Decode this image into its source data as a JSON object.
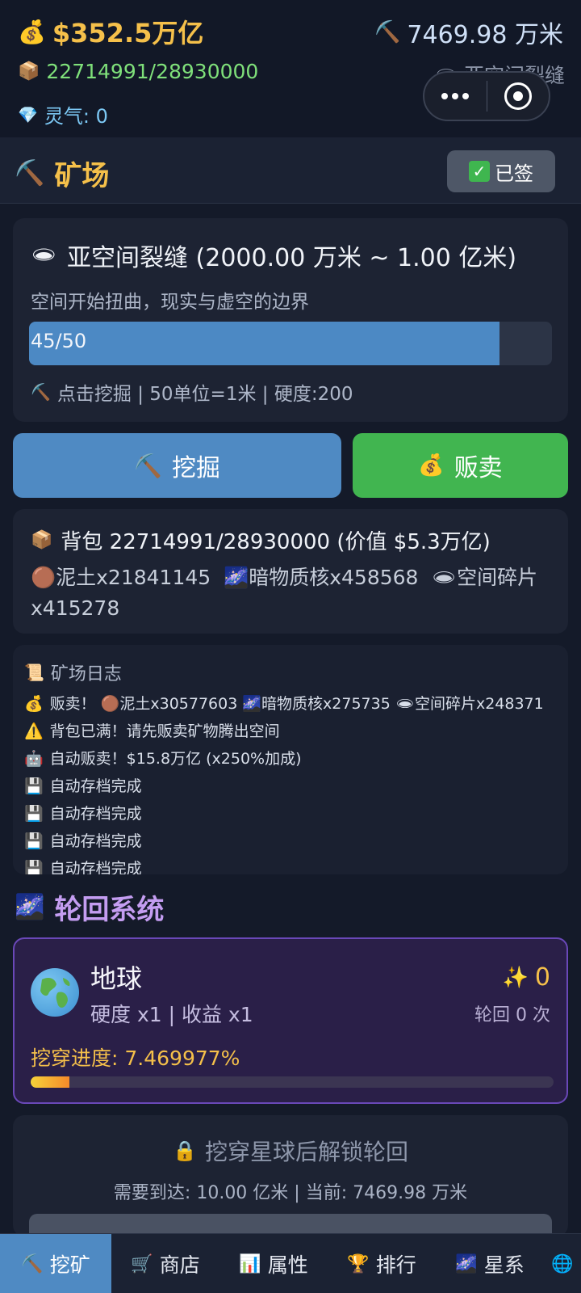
{
  "stats": {
    "money": "$352.5万亿",
    "depth": "7469.98 万米",
    "bag": "22714991/28930000",
    "layer": "亚空间裂缝",
    "qi": "灵气: 0"
  },
  "header": {
    "title": "矿场",
    "signed_label": "已签"
  },
  "layer_card": {
    "title": "亚空间裂缝 (2000.00 万米 ~ 1.00 亿米)",
    "description": "空间开始扭曲，现实与虚空的边界",
    "progress_label": "45/50",
    "progress_fraction": 0.9,
    "info": "点击挖掘 | 50单位=1米 | 硬度:200"
  },
  "actions": {
    "dig_label": "挖掘",
    "sell_label": "贩卖"
  },
  "bag_card": {
    "title": "背包 22714991/28930000 (价值 $5.3万亿)",
    "item_dirt": "泥土x21841145",
    "item_dark": "暗物质核x458568",
    "item_space": "空间碎片x415278"
  },
  "log": {
    "title": "矿场日志",
    "entries": [
      "贩卖！ 🟤泥土x30577603 🌌暗物质核x275735 🕳空间碎片x248371",
      "背包已满！请先贩卖矿物腾出空间",
      "自动贩卖！$15.8万亿 (x250%加成)",
      "自动存档完成",
      "自动存档完成",
      "自动存档完成",
      "自动存档完成"
    ]
  },
  "rebirth": {
    "section_title": "轮回系统",
    "planet_name": "地球",
    "multipliers": "硬度 x1 | 收益 x1",
    "stars": "0",
    "cycles": "轮回 0 次",
    "progress_label": "挖穿进度: 7.469977%",
    "progress_fraction": 0.0747
  },
  "locked": {
    "title": "挖穿星球后解锁轮回",
    "requirement": "需要到达: 10.00 亿米 | 当前: 7469.98 万米"
  },
  "nav": {
    "items": [
      "挖矿",
      "商店",
      "属性",
      "排行",
      "星系"
    ],
    "active": "挖矿"
  },
  "colors": {
    "accent_gold": "#f5c04a",
    "dig_blue": "#4f8ac3",
    "sell_green": "#41b550",
    "rebirth_purple": "#6a48b8"
  }
}
